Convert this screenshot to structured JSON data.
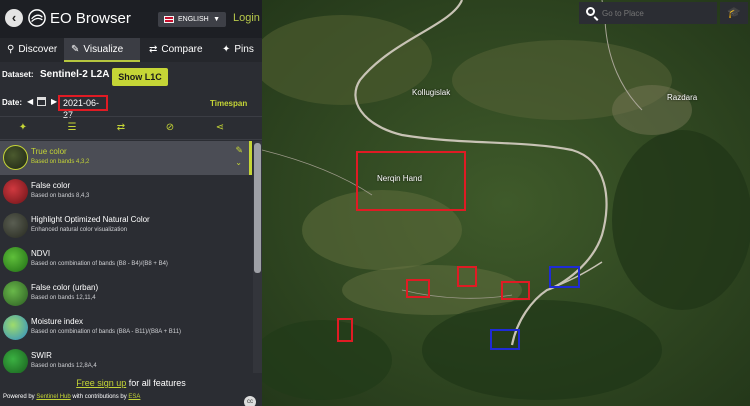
{
  "header": {
    "back_icon": "chevron-left-icon",
    "app_title": "EO Browser",
    "language": "ENGLISH",
    "login": "Login"
  },
  "tabs": [
    {
      "label": "Discover",
      "icon": "search-icon"
    },
    {
      "label": "Visualize",
      "icon": "brush-icon"
    },
    {
      "label": "Compare",
      "icon": "compare-icon"
    },
    {
      "label": "Pins",
      "icon": "pin-icon"
    }
  ],
  "dataset": {
    "label": "Dataset:",
    "value": "Sentinel-2 L2A",
    "show_l1c": "Show L1C"
  },
  "date": {
    "label": "Date:",
    "value": "2021-06-27",
    "timespan": "Timespan"
  },
  "layers": [
    {
      "name": "True color",
      "desc": "Based on bands 4,3,2"
    },
    {
      "name": "False color",
      "desc": "Based on bands 8,4,3"
    },
    {
      "name": "Highlight Optimized Natural Color",
      "desc": "Enhanced natural color visualization"
    },
    {
      "name": "NDVI",
      "desc": "Based on combination of bands (B8 - B4)/(B8 + B4)"
    },
    {
      "name": "False color (urban)",
      "desc": "Based on bands 12,11,4"
    },
    {
      "name": "Moisture index",
      "desc": "Based on combination of bands (B8A - B11)/(B8A + B11)"
    },
    {
      "name": "SWIR",
      "desc": "Based on bands 12,8A,4"
    }
  ],
  "footer": {
    "signup_link": "Free sign up",
    "signup_rest": " for all features",
    "powered_by": "Powered by ",
    "sentinel_hub": "Sentinel Hub",
    "with_contrib": " with contributions by ",
    "esa": "ESA"
  },
  "map": {
    "search_placeholder": "Go to Place",
    "places": [
      "Kollugislak",
      "Razdara",
      "Nerqin Hand"
    ]
  },
  "colors": {
    "accent": "#c5d536",
    "highlight_red": "#e01b24",
    "highlight_blue": "#1f2bd6"
  }
}
